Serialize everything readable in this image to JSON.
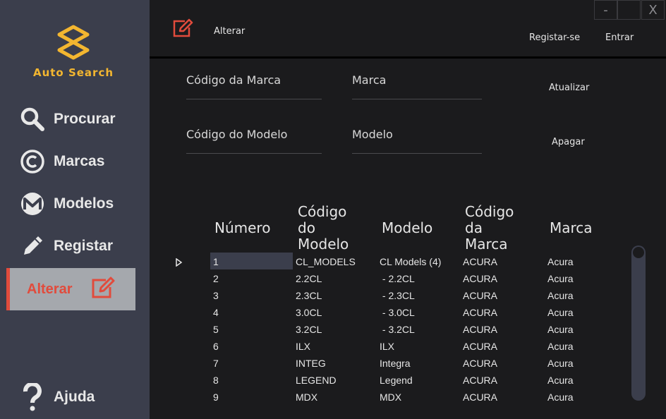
{
  "app": {
    "name": "Auto Search",
    "brand_color": "#f3b630",
    "accent": "#e14b3c"
  },
  "sidebar": {
    "items": [
      {
        "label": "Procurar",
        "icon": "search-icon"
      },
      {
        "label": "Marcas",
        "icon": "copyright-icon"
      },
      {
        "label": "Modelos",
        "icon": "monero-icon"
      },
      {
        "label": "Registar",
        "icon": "pencil-icon"
      },
      {
        "label": "Alterar",
        "icon": "edit-icon",
        "active": true
      }
    ],
    "help": {
      "label": "Ajuda",
      "icon": "question-icon"
    }
  },
  "header": {
    "title": "Alterar",
    "register_label": "Registar-se",
    "login_label": "Entrar",
    "window": {
      "minimize": "-",
      "close": "X"
    }
  },
  "form": {
    "brand_code_placeholder": "Código da Marca",
    "brand_placeholder": "Marca",
    "model_code_placeholder": "Código do Modelo",
    "model_placeholder": "Modelo",
    "update_label": "Atualizar",
    "delete_label": "Apagar"
  },
  "table": {
    "columns": [
      "Número",
      "Código do Modelo",
      "Modelo",
      "Código da Marca",
      "Marca"
    ],
    "rows": [
      [
        "1",
        "CL_MODELS",
        "CL Models (4)",
        "ACURA",
        "Acura"
      ],
      [
        "2",
        "2.2CL",
        " - 2.2CL",
        "ACURA",
        "Acura"
      ],
      [
        "3",
        "2.3CL",
        " - 2.3CL",
        "ACURA",
        "Acura"
      ],
      [
        "4",
        "3.0CL",
        " - 3.0CL",
        "ACURA",
        "Acura"
      ],
      [
        "5",
        "3.2CL",
        " - 3.2CL",
        "ACURA",
        "Acura"
      ],
      [
        "6",
        "ILX",
        "ILX",
        "ACURA",
        "Acura"
      ],
      [
        "7",
        "INTEG",
        "Integra",
        "ACURA",
        "Acura"
      ],
      [
        "8",
        "LEGEND",
        "Legend",
        "ACURA",
        "Acura"
      ],
      [
        "9",
        "MDX",
        "MDX",
        "ACURA",
        "Acura"
      ]
    ],
    "selected_row": 1
  }
}
